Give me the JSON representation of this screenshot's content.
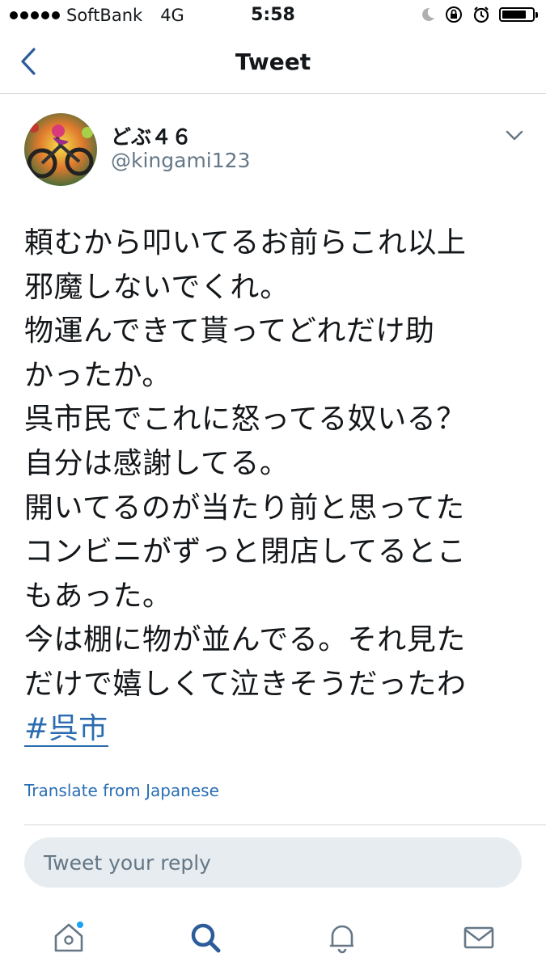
{
  "status_bar": {
    "carrier": "SoftBank",
    "network": "4G",
    "time": "5:58",
    "battery_level": 0.8
  },
  "nav": {
    "title": "Tweet"
  },
  "tweet": {
    "display_name": "どぶ４６",
    "handle": "@kingami123",
    "lines": [
      "頼むから叩いてるお前らこれ以上",
      "邪魔しないでくれ。",
      "物運んできて貰ってどれだけ助",
      "かったか。",
      "呉市民でこれに怒ってる奴いる？",
      "自分は感謝してる。",
      "開いてるのが当たり前と思ってた",
      "コンビニがずっと閉店してるとこ",
      "もあった。",
      "今は棚に物が並んでる。それ見た",
      "だけで嬉しくて泣きそうだったわ"
    ],
    "hashtag": "#呉市",
    "translate_label": "Translate from Japanese"
  },
  "reply": {
    "placeholder": "Tweet your reply"
  },
  "icons": {
    "back": "chevron-left-icon",
    "more": "chevron-down-icon",
    "home": "home-icon",
    "search": "search-icon",
    "notifications": "bell-icon",
    "messages": "envelope-icon"
  },
  "colors": {
    "accent": "#1da1f2",
    "link": "#2b6cb0",
    "active_tab": "#2c5d9a",
    "inactive_tab": "#657786",
    "reply_bg": "#e6ecf0"
  }
}
